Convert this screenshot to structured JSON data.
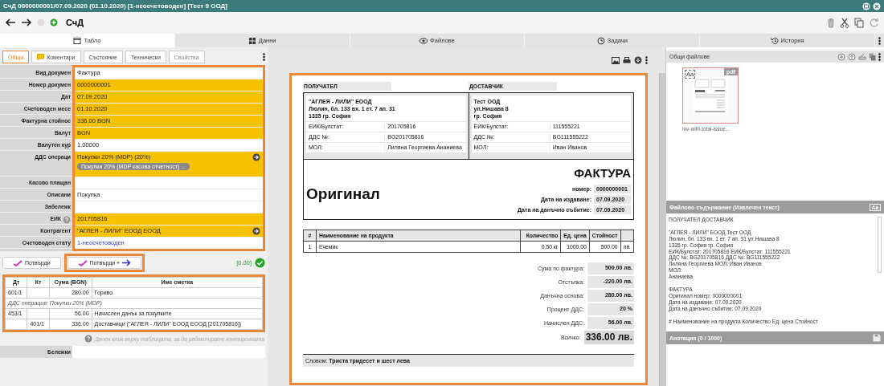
{
  "window": {
    "title": "СчД 0000000001/07.09.2020 (01.10.2020) [1-неосчетоводен] [Тест 9 ООД]"
  },
  "toolbar": {
    "title": "СчД"
  },
  "tabs": [
    {
      "label": "Табло",
      "selected": true
    },
    {
      "label": "Данни",
      "selected": false
    },
    {
      "label": "Файлове",
      "selected": false
    },
    {
      "label": "Задачи",
      "selected": false
    },
    {
      "label": "История",
      "selected": false
    }
  ],
  "left_panel": {
    "subtabs": [
      {
        "label": "Общи",
        "selected": true,
        "disabled": false
      },
      {
        "label": "Коментари",
        "selected": false,
        "disabled": false
      },
      {
        "label": "Състояние",
        "selected": false,
        "disabled": false
      },
      {
        "label": "Технически",
        "selected": false,
        "disabled": false
      },
      {
        "label": "Свойства",
        "selected": false,
        "disabled": true
      }
    ],
    "fields": [
      {
        "label": "Вид докумен",
        "kind": "text",
        "value": "Фактура",
        "highlighted": false
      },
      {
        "label": "Номер докумен",
        "kind": "text",
        "value": "0000000001",
        "highlighted": true
      },
      {
        "label": "Дат",
        "kind": "text",
        "value": "07.09.2020",
        "highlighted": true
      },
      {
        "label": "Счетоводен месе",
        "kind": "text",
        "value": "01.10.2020",
        "highlighted": true
      },
      {
        "label": "Фактурна стойнос",
        "kind": "text",
        "value": "336.00 BGN",
        "highlighted": true
      },
      {
        "label": "Валут",
        "kind": "text",
        "value": "BGN",
        "highlighted": true
      },
      {
        "label": "Валутен кур",
        "kind": "text",
        "value": "1.00000",
        "highlighted": false
      },
      {
        "label": "ДДС операци",
        "kind": "lookup",
        "value": "Покупки 20% (MDP) (20%)",
        "chip": "Покупки 20% (MDP касова отчетност) ...",
        "highlighted": true
      },
      {
        "label": "Касово плащан",
        "kind": "text",
        "highlighted": false
      },
      {
        "label": "Описани",
        "kind": "text",
        "value": "Покупка",
        "highlighted": false
      },
      {
        "label": "Забележк",
        "kind": "text",
        "highlighted": false
      },
      {
        "label": "ЕИК",
        "kind": "text_help",
        "value": "201705816",
        "highlighted": true
      },
      {
        "label": "Контрагент",
        "kind": "lookup",
        "value": "\"АГЛЕЯ - ЛИЛИ\" ЕООД ЕООД",
        "highlighted": true
      },
      {
        "label": "Счетоводен стату",
        "kind": "link",
        "value": "1-неосчетоводен",
        "highlighted": false
      }
    ],
    "buttons": [
      {
        "label": "Потвърди",
        "kind": "confirm"
      },
      {
        "label": "Потвърди +",
        "kind": "confirm_next"
      }
    ],
    "balance": "[0.00]",
    "entries": {
      "columns": [
        "Дт",
        "Кт",
        "Сума (BGN)",
        "Име сметка"
      ],
      "rows": [
        {
          "kind": "entry",
          "cells": [
            "601/1",
            null,
            "280.00",
            "Гориво"
          ]
        },
        {
          "kind": "note",
          "text": "ДДС операция: Покупки 20% (MDP)"
        },
        {
          "kind": "entry",
          "cells": [
            "453/1",
            null,
            "56.00",
            "Начислен данък за покупките"
          ]
        },
        {
          "kind": "entry",
          "cells": [
            null,
            "401/1",
            "336.00",
            "Доставчици (\"АГЛЕЯ - ЛИЛИ\" ЕООД ЕООД [201705816])"
          ]
        }
      ]
    },
    "hint": "Двоен клик върху таблицата, за да редактирате контировката",
    "notes": {
      "label": "Бележки"
    }
  },
  "document": {
    "parties": [
      {
        "heading": "ПОЛУЧАТЕЛ",
        "address": [
          "\"АГЛЕЯ - ЛИЛИ\" ЕООД",
          "Люлин, бл. 133 вх. 1 ет. 7 ап. 31",
          "1335 гр. София"
        ],
        "details": [
          {
            "label": "ЕИК/Булстат:",
            "value": "201705816"
          },
          {
            "label": "ДДС №:",
            "value": "BG201705816"
          },
          {
            "label": "МОЛ:",
            "value": "Лиляна Георгиева Ананиева"
          }
        ]
      },
      {
        "heading": "ДОСТАВЧИК",
        "address": [
          "Тест ООД",
          "ул.Нишава 8",
          "гр. София"
        ],
        "details": [
          {
            "label": "ЕИК/Булстат:",
            "value": "111555221"
          },
          {
            "label": "ДДС №:",
            "value": "BG111555222"
          },
          {
            "label": "МОЛ:",
            "value": "Иван Иванов"
          }
        ]
      }
    ],
    "title": "ФАКТУРА",
    "copy": "Оригинал",
    "meta": [
      {
        "label": "номер:",
        "value": "0000000001"
      },
      {
        "label": "Дата на издаване:",
        "value": "07.09.2020"
      },
      {
        "label": "Дата на данъчно събитие:",
        "value": "07.09.2020"
      }
    ],
    "items": {
      "columns": [
        "#",
        "Наименование на продукта",
        "Количество",
        "Ед. цена",
        "Стойност"
      ],
      "rows": [
        {
          "cells": [
            "1",
            "Ечемик",
            "0.50 кг",
            "1000.00",
            "500.00",
            "лв."
          ]
        }
      ]
    },
    "totals": [
      {
        "kind": "line",
        "label": "Сума по фактура:",
        "value": "500.00 лв."
      },
      {
        "kind": "line",
        "label": "Отстъпка:",
        "value": "-220.00 лв."
      },
      {
        "kind": "line",
        "label": "Данъчна основа:",
        "value": "280.00 лв."
      },
      {
        "kind": "line",
        "label": "Процент ДДС:",
        "value": "20 %"
      },
      {
        "kind": "line",
        "label": "Начислен ДДС:",
        "value": "56.00 лв."
      },
      {
        "kind": "grand",
        "label": "Всичко:",
        "value": "336.00 лв."
      }
    ],
    "in_words": "Словом: **Триста тридесет и шест лева**"
  },
  "files": {
    "title": "Общи файлове",
    "items": [
      {
        "name": "inv-with-total-issue...",
        "type": "pdf",
        "badge": "Aa"
      }
    ]
  },
  "content": {
    "title": "Файлово съдържание (Извлечен текст)",
    "icon_text": "Aa",
    "text": "ПОЛУЧАТЕЛ ДОСТАВЧИК\n\n\"АГЛЕЯ - ЛИЛИ\" ЕООД Тест ООД\nЛюлин, бл. 133 вх. 1 ет. 7 ап. 31 ул.Нишава 8\n1335 гр. София гр. София\nЕИК/Булстат: 201705816 ЕИК/Булстат: 111555221\nДДС №: BG201705816 ДДС №: BG111555222\nЛиляна Георгиева МОЛ: Иван Иванов\nМОЛ:\nАнаниева\n\nФАКТУРА\nОригинал номер: 0000000001\nДата на издаване: 07.09.2020\nДата на данъчно събитие: 07.09.2020\n\n# Наименование на продукта Количество Ед. цена Стойност"
  },
  "annotation": {
    "title": "Анотация (0 / 1000)"
  }
}
